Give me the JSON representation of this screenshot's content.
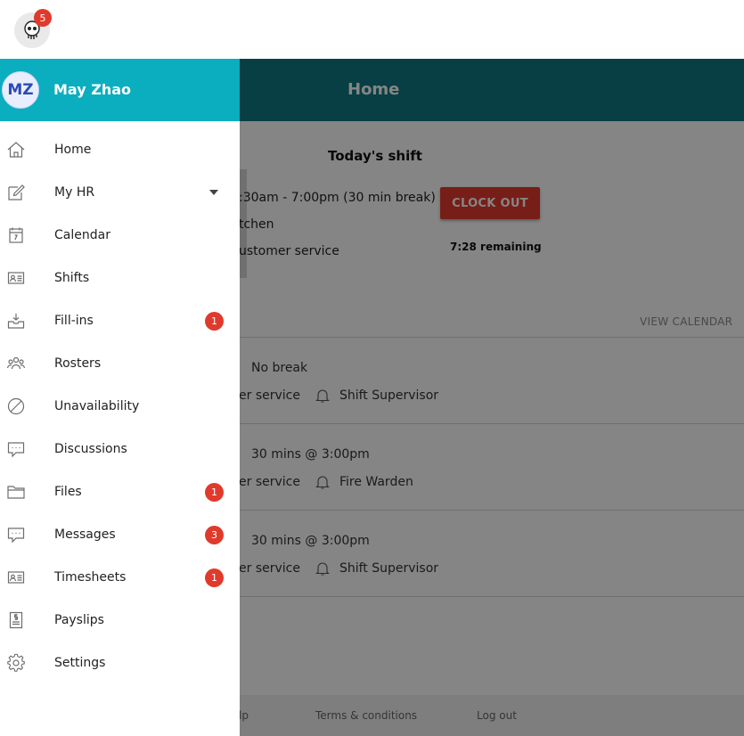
{
  "app": {
    "notification_count": "5"
  },
  "header": {
    "title": "Home"
  },
  "shift": {
    "title": "Today's shift",
    "time": ":30am - 7:00pm (30 min break)",
    "location": "tchen",
    "role": "ustomer service",
    "clock_out_label": "CLOCK OUT",
    "remaining": "7:28 remaining"
  },
  "upcoming": {
    "view_calendar": "VIEW CALENDAR",
    "items": [
      {
        "break": "No break",
        "role": "er service",
        "duty": "Shift Supervisor"
      },
      {
        "break": "30 mins @ 3:00pm",
        "role": "er service",
        "duty": "Fire Warden"
      },
      {
        "break": "30 mins @ 3:00pm",
        "role": "er service",
        "duty": "Shift Supervisor"
      }
    ]
  },
  "footer": {
    "help": "lp",
    "terms": "Terms & conditions",
    "logout": "Log out"
  },
  "drawer": {
    "initials": "MZ",
    "user_name": "May Zhao",
    "items": [
      {
        "label": "Home",
        "icon": "home-icon",
        "badge": ""
      },
      {
        "label": "My HR",
        "icon": "edit-icon",
        "badge": ""
      },
      {
        "label": "Calendar",
        "icon": "calendar-icon",
        "badge": ""
      },
      {
        "label": "Shifts",
        "icon": "id-card-icon",
        "badge": ""
      },
      {
        "label": "Fill-ins",
        "icon": "inbox-icon",
        "badge": "1"
      },
      {
        "label": "Rosters",
        "icon": "people-icon",
        "badge": ""
      },
      {
        "label": "Unavailability",
        "icon": "block-icon",
        "badge": ""
      },
      {
        "label": "Discussions",
        "icon": "chat-icon",
        "badge": ""
      },
      {
        "label": "Files",
        "icon": "folder-icon",
        "badge": "1"
      },
      {
        "label": "Messages",
        "icon": "message-icon",
        "badge": "3"
      },
      {
        "label": "Timesheets",
        "icon": "timesheet-icon",
        "badge": "1"
      },
      {
        "label": "Payslips",
        "icon": "payslip-icon",
        "badge": ""
      },
      {
        "label": "Settings",
        "icon": "gear-icon",
        "badge": ""
      }
    ]
  },
  "colors": {
    "header": "#0f7a82",
    "drawer_header": "#0aaebf",
    "badge": "#e03a2c",
    "clock_out": "#e23b2c"
  }
}
